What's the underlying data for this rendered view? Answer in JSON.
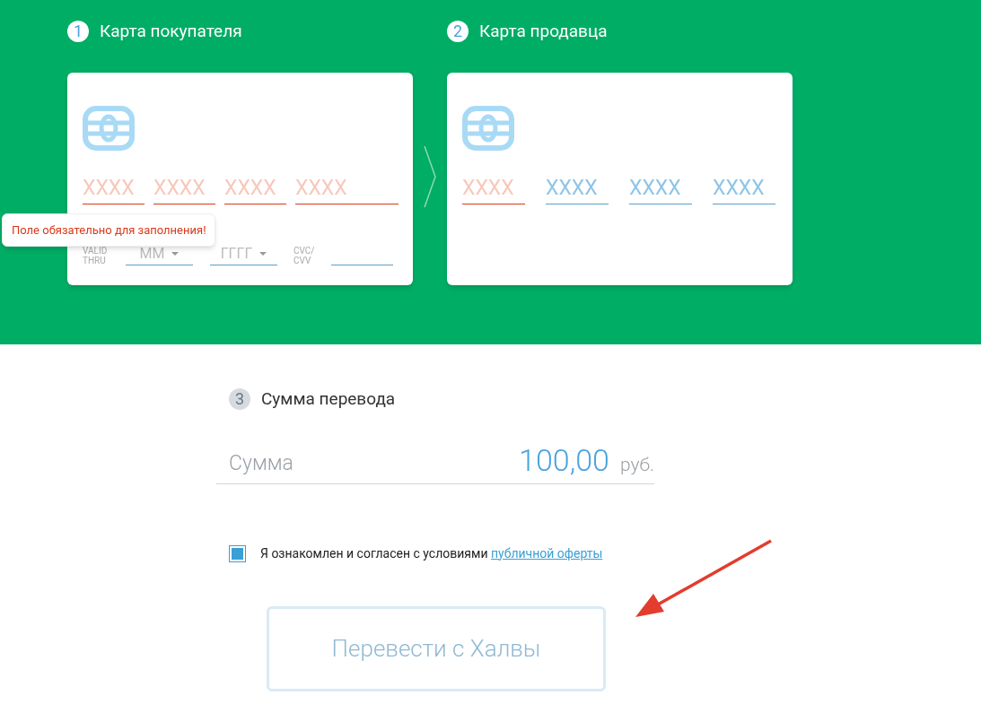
{
  "steps": [
    {
      "number": "1",
      "title": "Карта покупателя",
      "active": true,
      "card": {
        "number_fields": [
          {
            "placeholder": "XXXX",
            "error": true
          },
          {
            "placeholder": "XXXX",
            "error": true
          },
          {
            "placeholder": "XXXX",
            "error": true
          },
          {
            "placeholder": "XXXX",
            "error": true
          }
        ],
        "tooltip": "Поле обязательно для заполнения!",
        "expiry_label": "VALID THRU",
        "month": {
          "placeholder": "ММ"
        },
        "year": {
          "placeholder": "ГГГГ"
        },
        "cvc_label": "CVC/ CVV"
      }
    },
    {
      "number": "2",
      "title": "Карта продавца",
      "active": true,
      "card": {
        "number_fields": [
          {
            "placeholder": "XXXX",
            "error": true
          },
          {
            "placeholder": "XXXX",
            "error": false
          },
          {
            "placeholder": "XXXX",
            "error": false
          },
          {
            "placeholder": "XXXX",
            "error": false
          }
        ]
      }
    }
  ],
  "amount_step": {
    "number": "3",
    "title": "Сумма перевода",
    "active": false,
    "label": "Сумма",
    "value": "100,00",
    "currency": "руб."
  },
  "agreement": {
    "checked": true,
    "text": "Я ознакомлен и согласен с условиями",
    "link": "публичной оферты"
  },
  "submit": {
    "label": "Перевести с Халвы",
    "disabled": true
  }
}
